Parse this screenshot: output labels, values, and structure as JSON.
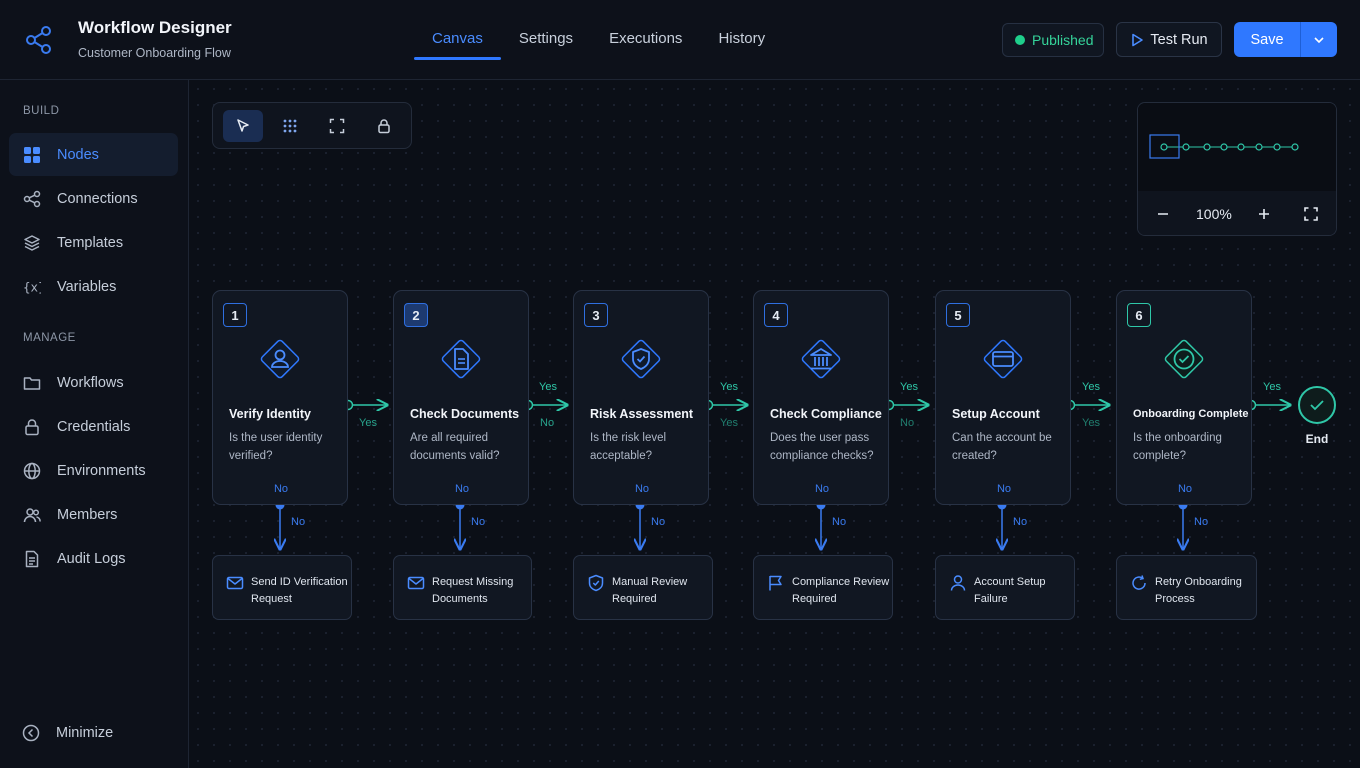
{
  "header": {
    "title": "Workflow Designer",
    "subtitle": "Customer Onboarding Flow",
    "tabs": [
      {
        "label": "Canvas",
        "active": true
      },
      {
        "label": "Settings"
      },
      {
        "label": "Executions"
      },
      {
        "label": "History"
      }
    ],
    "status": "Published",
    "test_run": "Test Run",
    "save": "Save"
  },
  "sidebar": {
    "build_label": "BUILD",
    "build_items": [
      {
        "label": "Nodes",
        "icon": "grid-icon",
        "active": true
      },
      {
        "label": "Connections",
        "icon": "share-icon"
      },
      {
        "label": "Templates",
        "icon": "layers-icon"
      },
      {
        "label": "Variables",
        "icon": "variable-icon"
      }
    ],
    "manage_label": "MANAGE",
    "manage_items": [
      {
        "label": "Workflows",
        "icon": "folder-icon"
      },
      {
        "label": "Credentials",
        "icon": "lock-icon"
      },
      {
        "label": "Environments",
        "icon": "globe-icon"
      },
      {
        "label": "Members",
        "icon": "users-icon"
      },
      {
        "label": "Audit Logs",
        "icon": "file-icon"
      }
    ],
    "minimize": "Minimize"
  },
  "zoom": {
    "level": "100%"
  },
  "nodes": [
    {
      "num": "1",
      "title": "Verify Identity",
      "desc": "Is the user identity verified?",
      "no": "No",
      "icon": "user-icon"
    },
    {
      "num": "2",
      "title": "Check Documents",
      "desc": "Are all required documents valid?",
      "no": "No",
      "icon": "document-icon"
    },
    {
      "num": "3",
      "title": "Risk Assessment",
      "desc": "Is the risk level acceptable?",
      "no": "No",
      "icon": "shield-icon"
    },
    {
      "num": "4",
      "title": "Check Compliance",
      "desc": "Does the user pass compliance checks?",
      "no": "No",
      "icon": "bank-icon"
    },
    {
      "num": "5",
      "title": "Setup Account",
      "desc": "Can the account be created?",
      "no": "No",
      "icon": "card-icon"
    },
    {
      "num": "6",
      "title": "Onboarding Complete",
      "desc": "Is the onboarding complete?",
      "no": "No",
      "icon": "check-circle-icon"
    }
  ],
  "connectors": {
    "yes": "Yes",
    "no": "No"
  },
  "failures": [
    {
      "line1": "Send ID Verification",
      "line2": "Request",
      "icon": "mail-icon"
    },
    {
      "line1": "Request Missing",
      "line2": "Documents",
      "icon": "mail-icon"
    },
    {
      "line1": "Manual Review",
      "line2": "Required",
      "icon": "shield-icon"
    },
    {
      "line1": "Compliance Review",
      "line2": "Required",
      "icon": "flag-icon"
    },
    {
      "line1": "Account Setup",
      "line2": "Failure",
      "icon": "user-icon"
    },
    {
      "line1": "Retry Onboarding",
      "line2": "Process",
      "icon": "refresh-icon"
    }
  ],
  "end_label": "End",
  "colors": {
    "accent": "#2f78ff",
    "success": "#2fc7a8",
    "status": "#1fcf8c"
  }
}
